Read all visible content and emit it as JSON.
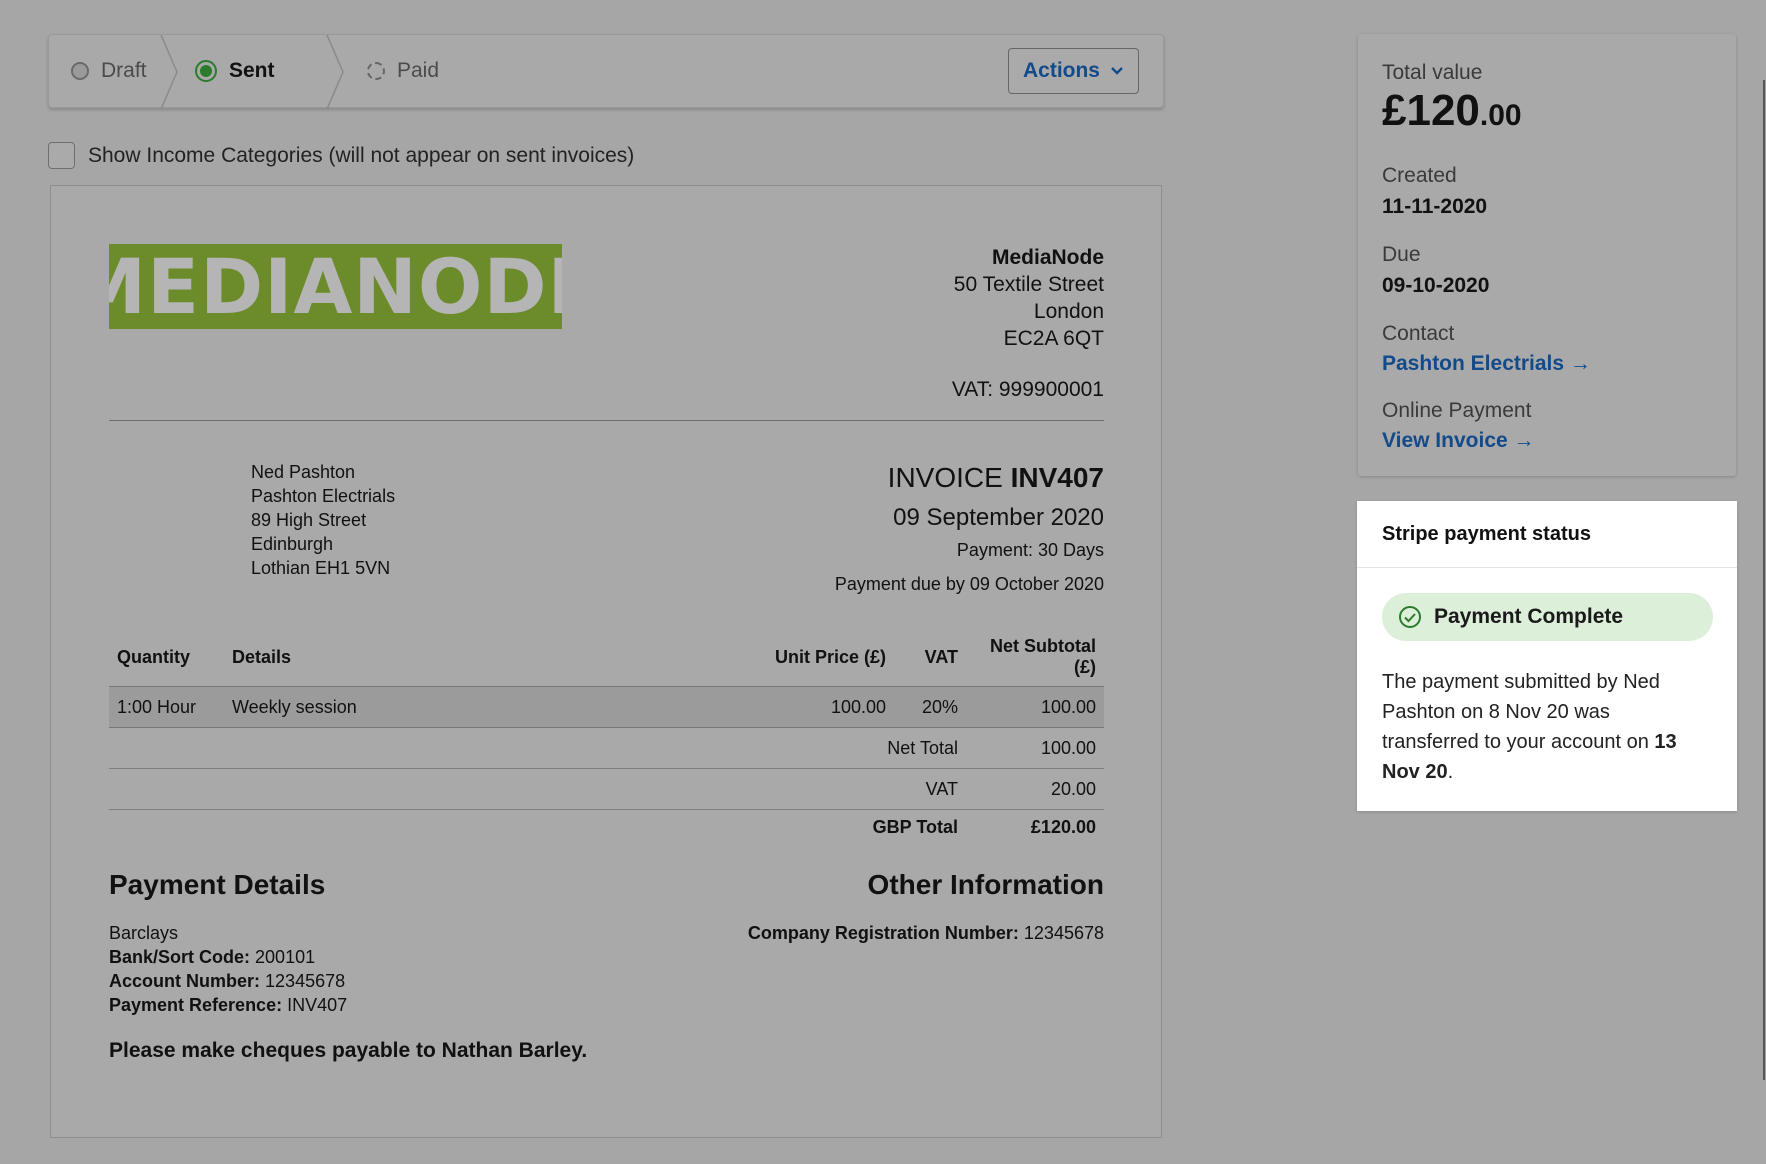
{
  "status": {
    "steps": [
      {
        "label": "Draft",
        "state": "done"
      },
      {
        "label": "Sent",
        "state": "active"
      },
      {
        "label": "Paid",
        "state": "pending"
      }
    ],
    "actions_label": "Actions"
  },
  "income_categories_label": "Show Income Categories (will not appear on sent invoices)",
  "invoice": {
    "logo_text": "MEDIANODE",
    "company": {
      "name": "MediaNode",
      "street": "50 Textile Street",
      "city": "London",
      "postcode": "EC2A 6QT",
      "vat": "VAT: 999900001"
    },
    "recipient": [
      "Ned Pashton",
      "Pashton Electrials",
      "89 High Street",
      "Edinburgh",
      "Lothian EH1 5VN"
    ],
    "title_prefix": "INVOICE",
    "number": "INV407",
    "date": "09 September 2020",
    "terms": "Payment: 30 Days",
    "due_text": "Payment due by 09 October 2020",
    "table": {
      "headers": [
        "Quantity",
        "Details",
        "Unit Price (£)",
        "VAT",
        "Net Subtotal (£)"
      ],
      "rows": [
        [
          "1:00 Hour",
          "Weekly session",
          "100.00",
          "20%",
          "100.00"
        ]
      ],
      "net_total_label": "Net Total",
      "net_total": "100.00",
      "vat_label": "VAT",
      "vat": "20.00",
      "gbp_total_label": "GBP Total",
      "gbp_total": "£120.00"
    },
    "payment_details": {
      "heading": "Payment Details",
      "bank": "Barclays",
      "sort_code_label": "Bank/Sort Code:",
      "sort_code": "200101",
      "account_label": "Account Number:",
      "account": "12345678",
      "reference_label": "Payment Reference:",
      "reference": "INV407",
      "cheque_note": "Please make cheques payable to Nathan Barley."
    },
    "other_info": {
      "heading": "Other Information",
      "reg_label": "Company Registration Number:",
      "reg_number": "12345678"
    }
  },
  "summary": {
    "total_label": "Total value",
    "total_main": "£120",
    "total_decimal": ".00",
    "created_label": "Created",
    "created": "11-11-2020",
    "due_label": "Due",
    "due": "09-10-2020",
    "contact_label": "Contact",
    "contact_link": "Pashton Electrials →",
    "online_label": "Online Payment",
    "online_link": "View Invoice →"
  },
  "stripe": {
    "title": "Stripe payment status",
    "badge": "Payment Complete",
    "message_start": "The payment submitted by Ned Pashton on 8 Nov 20 was transferred to your account on ",
    "message_date": "13 Nov 20",
    "message_end": ".",
    "badge_color": "#dcefd9",
    "check_color": "#2c7a2c"
  }
}
